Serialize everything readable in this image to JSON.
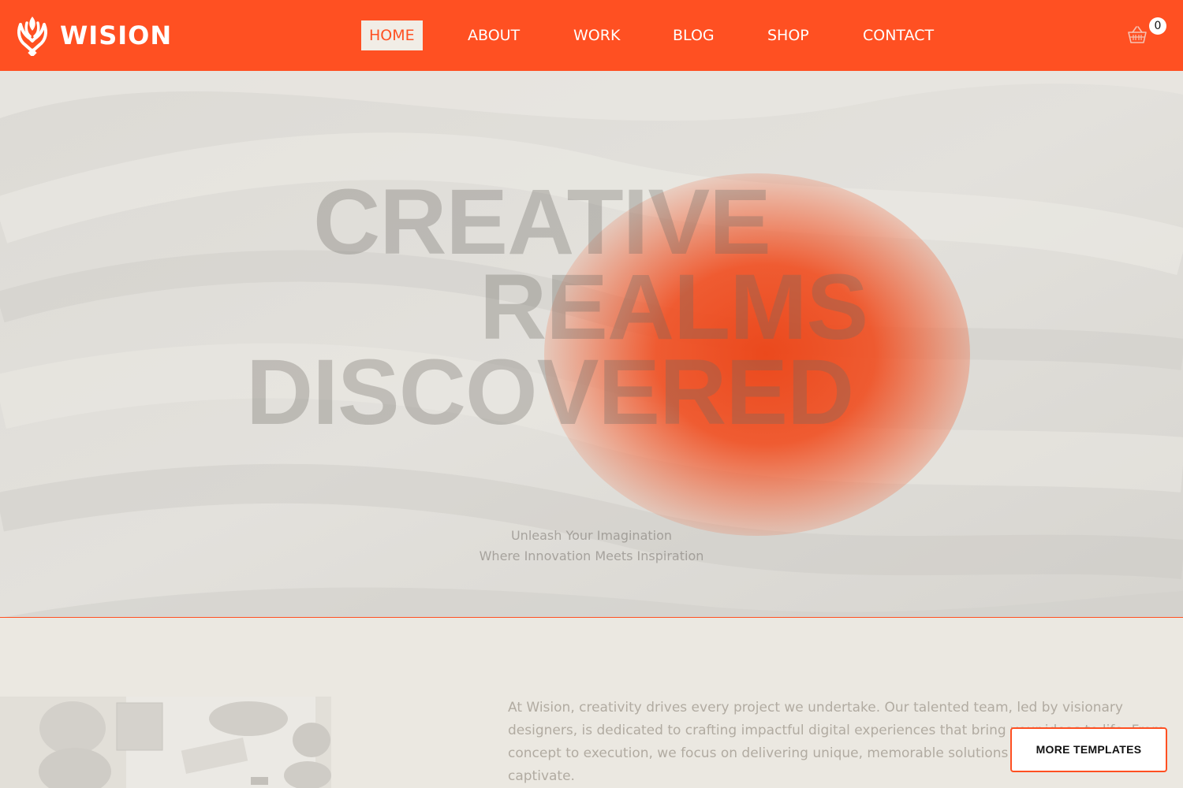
{
  "brand": {
    "name": "WISION",
    "accent": "#ff5022"
  },
  "nav": {
    "items": [
      {
        "label": "HOME",
        "active": true
      },
      {
        "label": "ABOUT"
      },
      {
        "label": "WORK"
      },
      {
        "label": "BLOG"
      },
      {
        "label": "SHOP"
      },
      {
        "label": "CONTACT"
      }
    ]
  },
  "cart": {
    "icon": "basket-icon",
    "count": "0"
  },
  "hero": {
    "title_line1": "CREATIVE",
    "title_line2": "REALMS",
    "title_line3": "DISCOVERED",
    "subtitle_line1": "Unleash Your Imagination",
    "subtitle_line2": "Where Innovation Meets Inspiration"
  },
  "about": {
    "text": "At Wision, creativity drives every project we undertake. Our talented team, led by visionary designers, is dedicated to crafting impactful digital experiences that bring your ideas to life. From concept to execution, we focus on delivering unique, memorable solutions that inspire and captivate."
  },
  "more_templates": {
    "label": "MORE TEMPLATES"
  }
}
